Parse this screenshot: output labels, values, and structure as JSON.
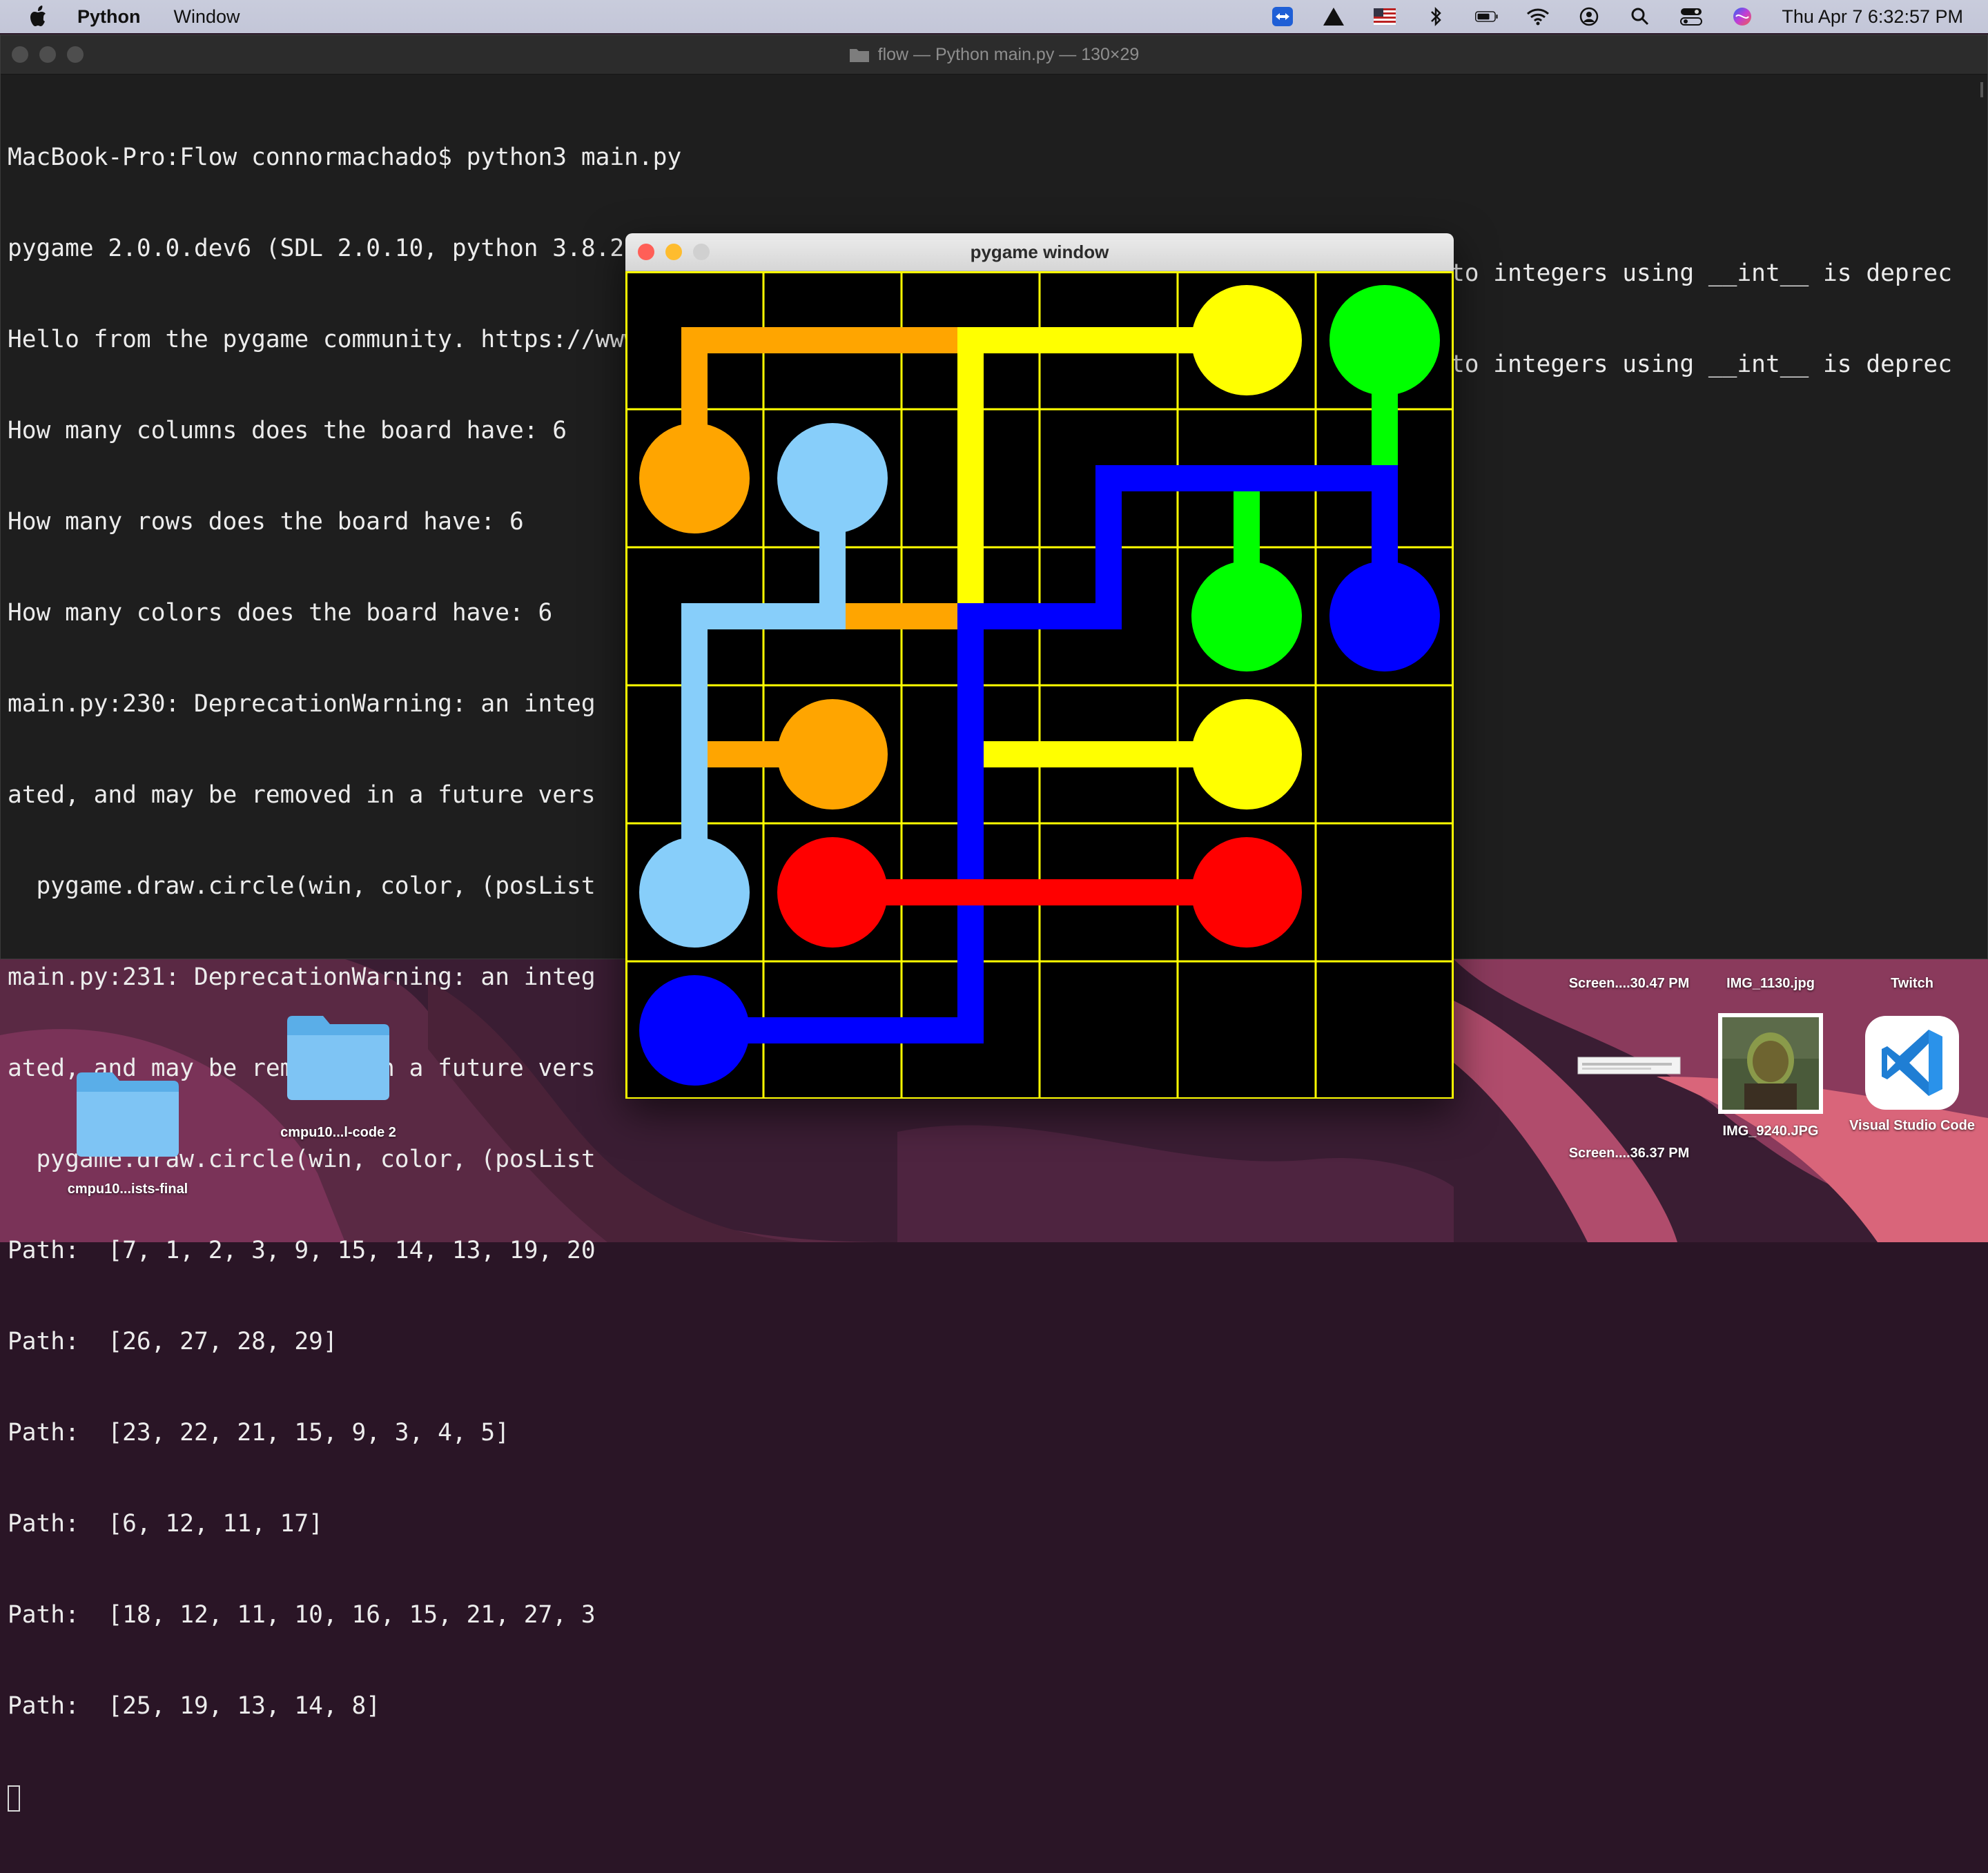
{
  "menubar": {
    "app_name": "Python",
    "menu_items": [
      "Window"
    ],
    "clock": "Thu Apr 7  6:32:57 PM"
  },
  "terminal": {
    "title": "flow — Python main.py — 130×29",
    "lines": [
      "MacBook-Pro:Flow connormachado$ python3 main.py",
      "pygame 2.0.0.dev6 (SDL 2.0.10, python 3.8.2)",
      "Hello from the pygame community. https://www.pygame.org/contribute.html",
      "How many columns does the board have: 6",
      "How many rows does the board have: 6",
      "How many colors does the board have: 6",
      "main.py:230: DeprecationWarning: an integ",
      "ated, and may be removed in a future vers",
      "  pygame.draw.circle(win, color, (posList",
      "main.py:231: DeprecationWarning: an integ",
      "ated, and may be removed in a future vers",
      "  pygame.draw.circle(win, color, (posList",
      "Path:  [7, 1, 2, 3, 9, 15, 14, 13, 19, 20",
      "Path:  [26, 27, 28, 29]",
      "Path:  [23, 22, 21, 15, 9, 3, 4, 5]",
      "Path:  [6, 12, 11, 17]",
      "Path:  [18, 12, 11, 10, 16, 15, 21, 27, 3",
      "Path:  [25, 19, 13, 14, 8]"
    ],
    "right_text_1": "to integers using __int__ is deprec",
    "right_text_2": "to integers using __int__ is deprec"
  },
  "pygame": {
    "title": "pygame window",
    "board": {
      "columns": 6,
      "rows": 6,
      "colors": {
        "orange": "#ffa500",
        "yellow": "#ffff00",
        "green": "#00ff00",
        "lightblue": "#87cefa",
        "blue": "#0000ff",
        "red": "#ff0000",
        "grid": "#ffff00"
      }
    }
  },
  "desktop": {
    "icons": [
      {
        "label": "cmpu10...ists-final",
        "icon": "folder-icon"
      },
      {
        "label": "cmpu10...l-code 2",
        "icon": "folder-icon"
      },
      {
        "label": "Screen....30.47 PM",
        "icon": "screenshot-icon"
      },
      {
        "label": "IMG_1130.jpg",
        "icon": "image-icon"
      },
      {
        "label": "Twitch",
        "icon": "twitch-icon"
      },
      {
        "label": "Screen....36.37 PM",
        "icon": "screenshot-icon"
      },
      {
        "label": "IMG_9240.JPG",
        "icon": "photo-icon"
      },
      {
        "label": "Visual Studio Code",
        "icon": "vscode-icon"
      }
    ]
  }
}
